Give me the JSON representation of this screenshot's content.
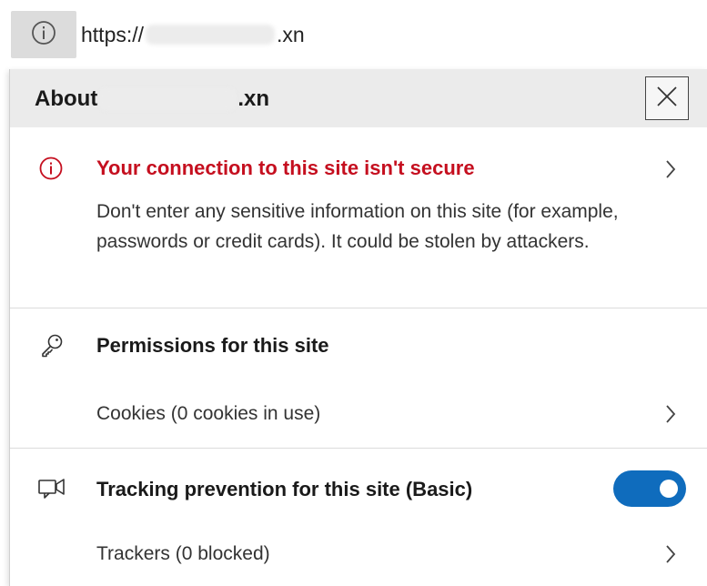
{
  "address_bar": {
    "url_prefix": "https://",
    "url_suffix": ".xn",
    "site_info_icon": "info-icon"
  },
  "flyout": {
    "title_prefix": "About",
    "title_suffix": ".xn",
    "close_icon": "close-icon",
    "connection": {
      "icon": "warning-info-icon",
      "title": "Your connection to this site isn't secure",
      "description": "Don't enter any sensitive information on this site (for example, passwords or credit cards). It could be stolen by attackers."
    },
    "permissions": {
      "icon": "key-icon",
      "title": "Permissions for this site",
      "cookies_label": "Cookies (0 cookies in use)"
    },
    "tracking": {
      "icon": "tracking-icon",
      "title": "Tracking prevention for this site (Basic)",
      "toggle_on": true,
      "trackers_label": "Trackers (0 blocked)"
    }
  },
  "colors": {
    "warning": "#c50f1f",
    "toggle": "#0f6cbd",
    "header_bg": "#ebebeb"
  }
}
